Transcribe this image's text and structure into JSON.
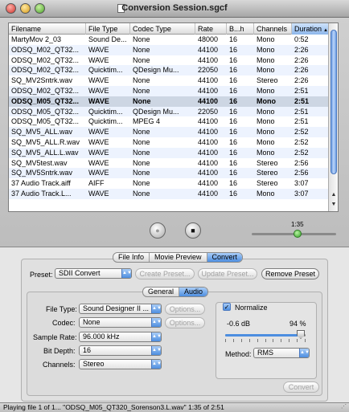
{
  "window": {
    "title": "Conversion Session.sgcf"
  },
  "table": {
    "columns": [
      "Filename",
      "File Type",
      "Codec Type",
      "Rate",
      "B...h",
      "Channels",
      "Duration"
    ],
    "sort_indicator": "▲",
    "rows": [
      [
        "MartyMov 2_03",
        "Sound De...",
        "None",
        "48000",
        "16",
        "Mono",
        "0:52"
      ],
      [
        "ODSQ_M02_QT32...",
        "WAVE",
        "None",
        "44100",
        "16",
        "Mono",
        "2:26"
      ],
      [
        "ODSQ_M02_QT32...",
        "WAVE",
        "None",
        "44100",
        "16",
        "Mono",
        "2:26"
      ],
      [
        "ODSQ_M02_QT32...",
        "Quicktim...",
        "QDesign Mu...",
        "22050",
        "16",
        "Mono",
        "2:26"
      ],
      [
        "SQ_MV2Sntrk.wav",
        "WAVE",
        "None",
        "44100",
        "16",
        "Stereo",
        "2:26"
      ],
      [
        "ODSQ_M02_QT32...",
        "WAVE",
        "None",
        "44100",
        "16",
        "Mono",
        "2:51"
      ],
      [
        "ODSQ_M05_QT32...",
        "WAVE",
        "None",
        "44100",
        "16",
        "Mono",
        "2:51"
      ],
      [
        "ODSQ_M05_QT32...",
        "Quicktim...",
        "QDesign Mu...",
        "22050",
        "16",
        "Mono",
        "2:51"
      ],
      [
        "ODSQ_M05_QT32...",
        "Quicktim...",
        "MPEG 4",
        "44100",
        "16",
        "Mono",
        "2:51"
      ],
      [
        "SQ_MV5_ALL.wav",
        "WAVE",
        "None",
        "44100",
        "16",
        "Mono",
        "2:52"
      ],
      [
        "SQ_MV5_ALL.R.wav",
        "WAVE",
        "None",
        "44100",
        "16",
        "Mono",
        "2:52"
      ],
      [
        "SQ_MV5_ALL.L.wav",
        "WAVE",
        "None",
        "44100",
        "16",
        "Mono",
        "2:52"
      ],
      [
        "SQ_MV5test.wav",
        "WAVE",
        "None",
        "44100",
        "16",
        "Stereo",
        "2:56"
      ],
      [
        "SQ_MV5Sntrk.wav",
        "WAVE",
        "None",
        "44100",
        "16",
        "Stereo",
        "2:56"
      ],
      [
        "37 Audio Track.aiff",
        "AIFF",
        "None",
        "44100",
        "16",
        "Stereo",
        "3:07"
      ],
      [
        "37 Audio Track.L...",
        "WAVE",
        "None",
        "44100",
        "16",
        "Mono",
        "3:07"
      ]
    ],
    "selected_index": 6
  },
  "transport": {
    "play_glyph": "●",
    "stop_glyph": "■",
    "time_label": "1:35",
    "progress": 0.54
  },
  "tabs": {
    "items": [
      "File Info",
      "Movie Preview",
      "Convert"
    ],
    "active": 2
  },
  "preset": {
    "label": "Preset:",
    "value": "SDII Convert",
    "create_button": "Create Preset...",
    "update_button": "Update Preset...",
    "remove_button": "Remove Preset"
  },
  "subtabs": {
    "items": [
      "General",
      "Audio"
    ],
    "active": 1
  },
  "audio": {
    "file_type": {
      "label": "File Type:",
      "value": "Sound Designer II ..."
    },
    "codec": {
      "label": "Codec:",
      "value": "None"
    },
    "sample_rate": {
      "label": "Sample Rate:",
      "value": "96.000 kHz"
    },
    "bit_depth": {
      "label": "Bit Depth:",
      "value": "16"
    },
    "channels": {
      "label": "Channels:",
      "value": "Stereo"
    },
    "options_label": "Options...",
    "normalize": {
      "label": "Normalize",
      "checked": true,
      "db_label": "-0.6 dB",
      "percent_label": "94 %",
      "level": 0.94
    },
    "method": {
      "label": "Method:",
      "value": "RMS"
    },
    "convert_button": "Convert"
  },
  "status": {
    "text": "Playing file 1 of 1... \"ODSQ_M05_QT320_Sorenson3.L.wav\" 1:35 of 2:51",
    "resize_glyph": "⋰"
  },
  "colors": {
    "accent": "#4d8ee0",
    "selection": "#cdd6e3",
    "stripe": "#edf3fe"
  }
}
